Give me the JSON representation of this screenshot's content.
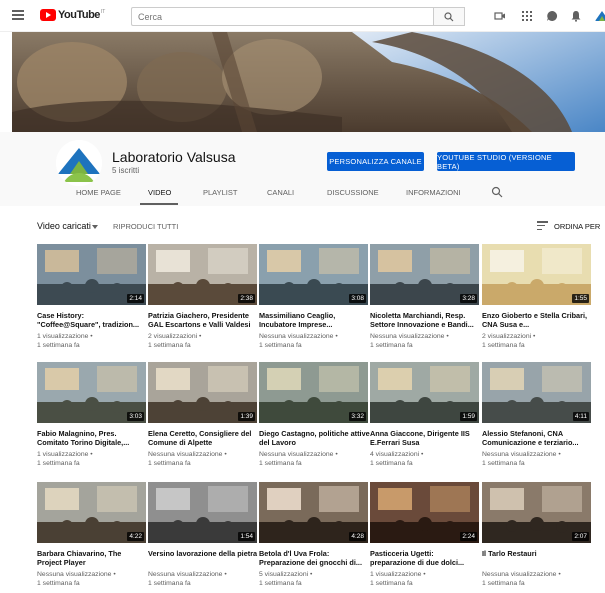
{
  "header": {
    "logo_text": "YouTube",
    "logo_sup": "IT",
    "search_placeholder": "Cerca"
  },
  "channel": {
    "name": "Laboratorio Valsusa",
    "subscribers": "5 iscritti",
    "customize_button": "PERSONALIZZA CANALE",
    "studio_button": "YOUTUBE STUDIO (VERSIONE BETA)"
  },
  "tabs": [
    "HOME PAGE",
    "VIDEO",
    "PLAYLIST",
    "CANALI",
    "DISCUSSIONE",
    "INFORMAZIONI"
  ],
  "active_tab": "VIDEO",
  "toolbar": {
    "uploads_label": "Video caricati",
    "play_all": "RIPRODUCI TUTTI",
    "sort_label": "ORDINA PER"
  },
  "videos": [
    {
      "title": "Case History: \"Coffee@Square\", tradizion...",
      "views": "1 visualizzazione •",
      "date": "1 settimana fa",
      "duration": "2:14"
    },
    {
      "title": "Patrizia Giachero, Presidente GAL Escartons e Valli Valdesi",
      "views": "2 visualizzazioni •",
      "date": "1 settimana fa",
      "duration": "2:38"
    },
    {
      "title": "Massimiliano Ceaglio, Incubatore Imprese...",
      "views": "Nessuna visualizzazione •",
      "date": "1 settimana fa",
      "duration": "3:08"
    },
    {
      "title": "Nicoletta Marchiandi, Resp. Settore Innovazione e Bandi...",
      "views": "Nessuna visualizzazione •",
      "date": "1 settimana fa",
      "duration": "3:28"
    },
    {
      "title": "Enzo Gioberto e Stella Cribari, CNA Susa e...",
      "views": "2 visualizzazioni •",
      "date": "1 settimana fa",
      "duration": "1:55"
    },
    {
      "title": "Fabio Malagnino, Pres. Comitato Torino Digitale,...",
      "views": "1 visualizzazione •",
      "date": "1 settimana fa",
      "duration": "3:03"
    },
    {
      "title": "Elena Ceretto, Consigliere del Comune di Alpette",
      "views": "Nessuna visualizzazione •",
      "date": "1 settimana fa",
      "duration": "1:39"
    },
    {
      "title": "Diego Castagno, politiche attive del Lavoro",
      "views": "Nessuna visualizzazione •",
      "date": "1 settimana fa",
      "duration": "3:32"
    },
    {
      "title": "Anna Giaccone, Dirigente IIS E.Ferrari Susa",
      "views": "4 visualizzazioni •",
      "date": "1 settimana fa",
      "duration": "1:59"
    },
    {
      "title": "Alessio Stefanoni, CNA Comunicazione e terziario...",
      "views": "Nessuna visualizzazione •",
      "date": "1 settimana fa",
      "duration": "4:11"
    },
    {
      "title": "Barbara Chiavarino, The Project Player",
      "views": "Nessuna visualizzazione •",
      "date": "1 settimana fa",
      "duration": "4:22"
    },
    {
      "title": "Versino lavorazione della pietra",
      "views": "Nessuna visualizzazione •",
      "date": "1 settimana fa",
      "duration": "1:54"
    },
    {
      "title": "Betola d'l Uva Frola: Preparazione dei gnocchi di...",
      "views": "5 visualizzazioni •",
      "date": "1 settimana fa",
      "duration": "4:28"
    },
    {
      "title": "Pasticceria Ugetti: preparazione di due dolci...",
      "views": "1 visualizzazione •",
      "date": "1 settimana fa",
      "duration": "2:24"
    },
    {
      "title": "Il Tarlo Restauri",
      "views": "Nessuna visualizzazione •",
      "date": "1 settimana fa",
      "duration": "2:07"
    }
  ],
  "colors": {
    "accent": "#065fd4",
    "logo_red": "#ff0000"
  }
}
